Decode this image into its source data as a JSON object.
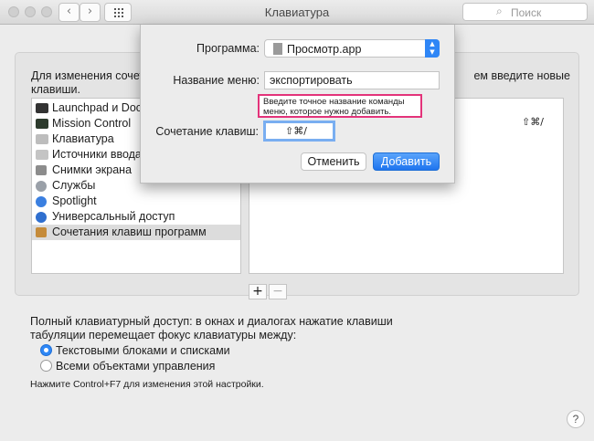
{
  "window": {
    "title": "Клавиатура",
    "search_placeholder": "Поиск",
    "back": "‹",
    "forward": "›"
  },
  "main": {
    "intro_left": "Для изменения сочета",
    "intro_left_2": "клавиши.",
    "intro_right": "ем введите новые",
    "categories": [
      {
        "label": "Launchpad и Dock",
        "icon": "launchpad-icon"
      },
      {
        "label": "Mission Control",
        "icon": "mission-control-icon"
      },
      {
        "label": "Клавиатура",
        "icon": "keyboard-icon"
      },
      {
        "label": "Источники ввода",
        "icon": "input-sources-icon"
      },
      {
        "label": "Снимки экрана",
        "icon": "screenshot-icon"
      },
      {
        "label": "Службы",
        "icon": "services-gear-icon"
      },
      {
        "label": "Spotlight",
        "icon": "spotlight-icon"
      },
      {
        "label": "Универсальный доступ",
        "icon": "accessibility-icon"
      },
      {
        "label": "Сочетания клавиш программ",
        "icon": "app-shortcuts-icon"
      }
    ],
    "shortcut_display": "⇧⌘/",
    "add": "+",
    "remove": "−",
    "full_access_text": "Полный клавиатурный доступ: в окнах и диалогах нажатие клавиши табуляции перемещает фокус клавиатуры между:",
    "radio_text_boxes": "Текстовыми блоками и списками",
    "radio_all_controls": "Всеми объектами управления",
    "hint": "Нажмите Control+F7 для изменения этой настройки.",
    "help": "?"
  },
  "dialog": {
    "program_label": "Программа:",
    "program_value": "Просмотр.app",
    "menu_label": "Название меню:",
    "menu_value": "экспортировать",
    "callout": "Введите точное название команды меню, которое нужно добавить.",
    "shortcut_label": "Сочетание клавиш:",
    "shortcut_value": "⇧⌘/",
    "cancel": "Отменить",
    "add": "Добавить"
  },
  "colors": {
    "accent": "#2e87f6",
    "callout_border": "#e3337a"
  }
}
